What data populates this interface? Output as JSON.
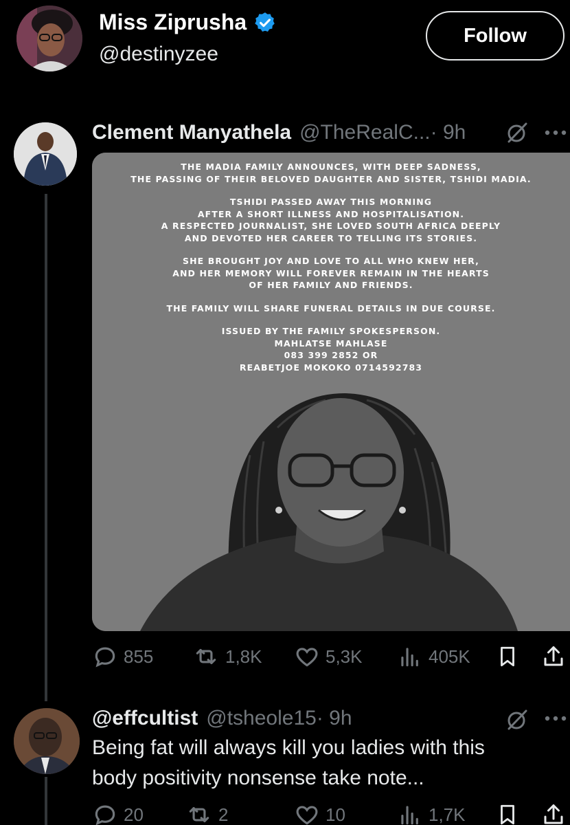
{
  "header": {
    "name": "Miss Ziprusha",
    "handle": "@destinyzee",
    "follow_label": "Follow"
  },
  "tweets": [
    {
      "author": "Clement Manyathela",
      "handle": "@TheRealC...",
      "time": "· 9h",
      "notice_paragraphs": [
        [
          "THE MADIA FAMILY ANNOUNCES, WITH DEEP SADNESS,",
          "THE PASSING OF THEIR BELOVED DAUGHTER AND SISTER, TSHIDI MADIA."
        ],
        [
          "TSHIDI PASSED AWAY THIS MORNING",
          "AFTER A SHORT ILLNESS AND HOSPITALISATION.",
          "A RESPECTED JOURNALIST, SHE LOVED SOUTH AFRICA DEEPLY",
          "AND DEVOTED HER CAREER TO TELLING ITS STORIES."
        ],
        [
          "SHE BROUGHT JOY AND LOVE TO ALL WHO KNEW HER,",
          "AND HER MEMORY WILL FOREVER REMAIN IN THE HEARTS",
          "OF HER FAMILY AND FRIENDS."
        ],
        [
          "THE FAMILY WILL SHARE FUNERAL DETAILS IN DUE COURSE."
        ],
        [
          "ISSUED BY THE FAMILY SPOKESPERSON.",
          "MAHLATSE MAHLASE",
          "083 399 2852   OR",
          "REABETJOE MOKOKO 0714592783"
        ]
      ],
      "stats": {
        "replies": "855",
        "reposts": "1,8K",
        "likes": "5,3K",
        "views": "405K"
      }
    },
    {
      "author": "@effcultist",
      "handle": "@tsheole15",
      "time": "· 9h",
      "text_lines": [
        "Being fat will always kill you ladies with this",
        "body positivity nonsense take note..."
      ],
      "stats": {
        "replies": "20",
        "reposts": "2",
        "likes": "10",
        "views": "1,7K"
      }
    }
  ],
  "icons": {
    "verified": "verified-badge-icon",
    "grok": "grok-icon",
    "more": "more-icon",
    "reply": "reply-icon",
    "repost": "repost-icon",
    "like": "like-icon",
    "views": "views-icon",
    "bookmark": "bookmark-icon",
    "share": "share-icon"
  },
  "colors": {
    "background": "#000000",
    "text": "#e7e9ea",
    "muted": "#71767b",
    "verified": "#1d9bf0"
  }
}
